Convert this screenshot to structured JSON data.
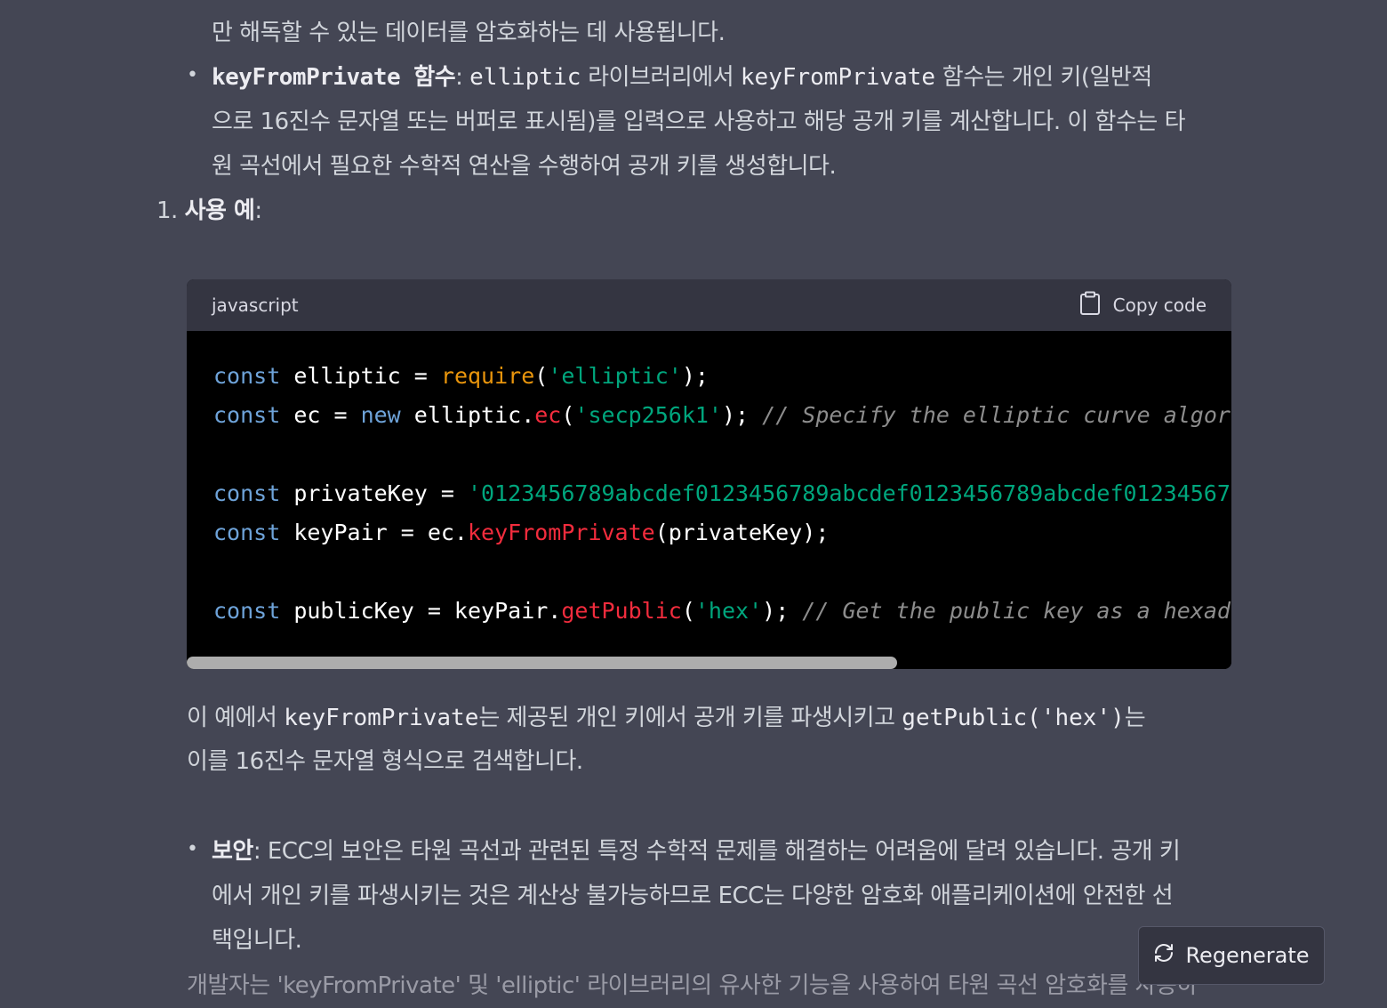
{
  "content": {
    "line_top": "만 해독할 수 있는 데이터를 암호화하는 데 사용됩니다.",
    "kfp_item": {
      "term": "keyFromPrivate 함수",
      "l1_a": ": ",
      "l1_code1": "elliptic",
      "l1_b": " 라이브러리에서 ",
      "l1_code2": "keyFromPrivate",
      "l1_c": " 함수는 개인 키(일반적",
      "l2": "으로 16진수 문자열 또는 버퍼로 표시됨)를 입력으로 사용하고 해당 공개 키를 계산합니다. 이 함수는 타",
      "l3": "원 곡선에서 필요한 수학적 연산을 수행하여 공개 키를 생성합니다."
    },
    "numbered_item": {
      "number": "1.",
      "label": "사용 예",
      "colon": ":"
    },
    "after_code": {
      "l1_a": "이 예에서 ",
      "l1_code1": "keyFromPrivate",
      "l1_b": "는 제공된 개인 키에서 공개 키를 파생시키고 ",
      "l1_code2": "getPublic('hex')",
      "l1_c": "는",
      "l2": "이를 16진수 문자열 형식으로 검색합니다."
    },
    "security_item": {
      "term": "보안",
      "l1": ": ECC의 보안은 타원 곡선과 관련된 특정 수학적 문제를 해결하는 어려움에 달려 있습니다. 공개 키",
      "l2": "에서 개인 키를 파생시키는 것은 계산상 불가능하므로 ECC는 다양한 암호화 애플리케이션에 안전한 선",
      "l3": "택입니다."
    },
    "bottom_line": "개발자는 'keyFromPrivate' 및 'elliptic' 라이브러리의 유사한 기능을 사용하여 타원 곡선 암호화를 사용하"
  },
  "code_block": {
    "language": "javascript",
    "copy_label": "Copy code",
    "lines": [
      {
        "kw": "const",
        "name": " elliptic = ",
        "fn": "require",
        "p1": "(",
        "str": "'elliptic'",
        "p2": ");"
      },
      {
        "kw": "const",
        "name": " ec = ",
        "kw2": "new",
        "obj": " elliptic.",
        "fn": "ec",
        "p1": "(",
        "str": "'secp256k1'",
        "p2": "); ",
        "comment": "// Specify the elliptic curve algor"
      },
      {
        "kw": "const",
        "name": " privateKey = ",
        "str": "'0123456789abcdef0123456789abcdef0123456789abcdef01234567"
      },
      {
        "kw": "const",
        "name": " keyPair = ec.",
        "fn": "keyFromPrivate",
        "p2": "(privateKey);"
      },
      {
        "kw": "const",
        "name": " publicKey = keyPair.",
        "fn": "getPublic",
        "p1": "(",
        "str": "'hex'",
        "p2": "); ",
        "comment": "// Get the public key as a hexad"
      }
    ],
    "scroll_fraction_visible": 0.68
  },
  "regenerate_button": {
    "label": "Regenerate",
    "icon": "refresh-icon"
  }
}
